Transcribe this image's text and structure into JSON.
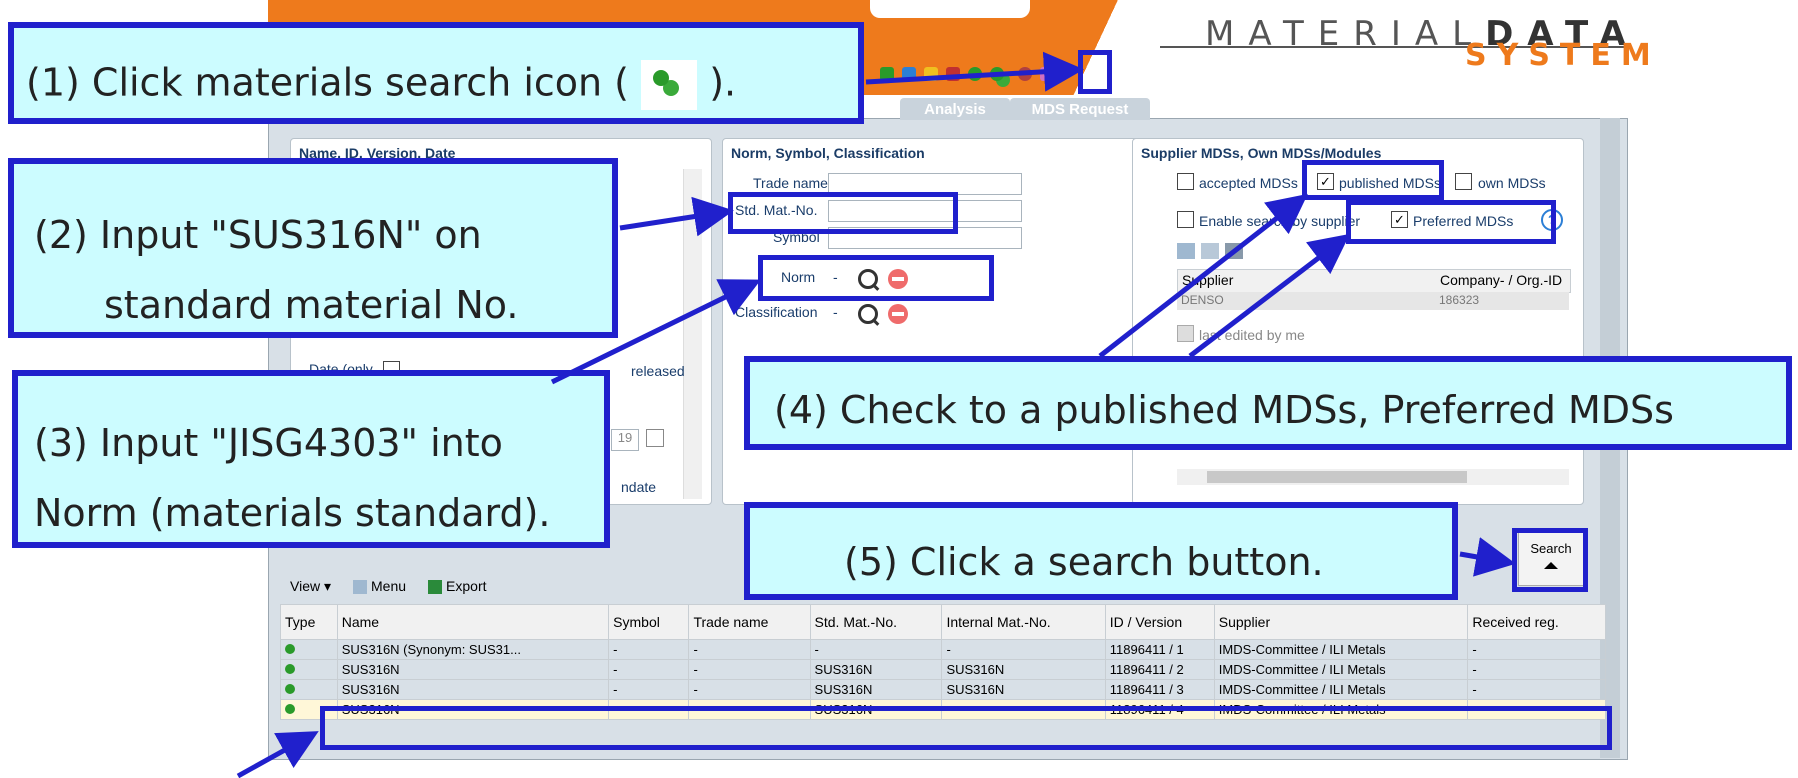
{
  "header": {
    "logo_top_light": "MATERIAL",
    "logo_top_bold": "DATA",
    "logo_bottom": "SYSTEM"
  },
  "tabs": [
    "Analysis",
    "MDS Request"
  ],
  "panel_name": {
    "title": "Name, ID, Version, Date",
    "date_label": "Date (only",
    "released_text": "released",
    "date_value": "19",
    "candidate_text": "ndate"
  },
  "panel_norm": {
    "title": "Norm, Symbol, Classification",
    "trade_name_label": "Trade name",
    "std_mat_label": "Std. Mat.-No.",
    "symbol_label": "Symbol",
    "norm_label": "Norm",
    "classification_label": "Classification",
    "dash": "-"
  },
  "panel_supplier": {
    "title": "Supplier MDSs, Own MDSs/Modules",
    "accepted_label": "accepted MDSs",
    "published_label": "published MDSs",
    "own_label": "own MDSs",
    "enable_label": "Enable search by supplier",
    "preferred_label": "Preferred MDSs",
    "col_supplier": "Supplier",
    "col_company": "Company- / Org.-ID",
    "supplier_row": {
      "supplier": "DENSO",
      "company": "186323"
    },
    "last_edited_label": "last edited by me"
  },
  "search_button": "Search",
  "grid_toolbar": {
    "view": "View",
    "menu": "Menu",
    "export": "Export"
  },
  "table": {
    "columns": [
      "Type",
      "Name",
      "Symbol",
      "Trade name",
      "Std. Mat.-No.",
      "Internal Mat.-No.",
      "ID / Version",
      "Supplier",
      "Received reg."
    ],
    "rows": [
      [
        "",
        "SUS316N (Synonym: SUS31...",
        "-",
        "-",
        "-",
        "-",
        "11896411 / 1",
        "IMDS-Committee / ILI Metals",
        "-"
      ],
      [
        "",
        "SUS316N",
        "-",
        "-",
        "SUS316N",
        "SUS316N",
        "11896411 / 2",
        "IMDS-Committee / ILI Metals",
        "-"
      ],
      [
        "",
        "SUS316N",
        "-",
        "-",
        "SUS316N",
        "SUS316N",
        "11896411 / 3",
        "IMDS-Committee / ILI Metals",
        "-"
      ],
      [
        "",
        "SUS316N",
        "-",
        "-",
        "SUS316N",
        "-",
        "11896411 / 4",
        "IMDS-Committee / ILI Metals",
        "-"
      ]
    ]
  },
  "callouts": {
    "step1_a": "(1) Click materials search icon (",
    "step1_b": ").",
    "step2_a": "(2) Input \"SUS316N\" on",
    "step2_b": "standard material No.",
    "step3_a": "(3) Input \"JISG4303\" into",
    "step3_b": "Norm (materials standard).",
    "step4": "(4) Check to a published MDSs, Preferred MDSs",
    "step5": "(5) Click a search button."
  },
  "colors": {
    "accent": "#ee7a1c",
    "annotation_border": "#2020cc",
    "annotation_fill": "#ccfcff"
  }
}
